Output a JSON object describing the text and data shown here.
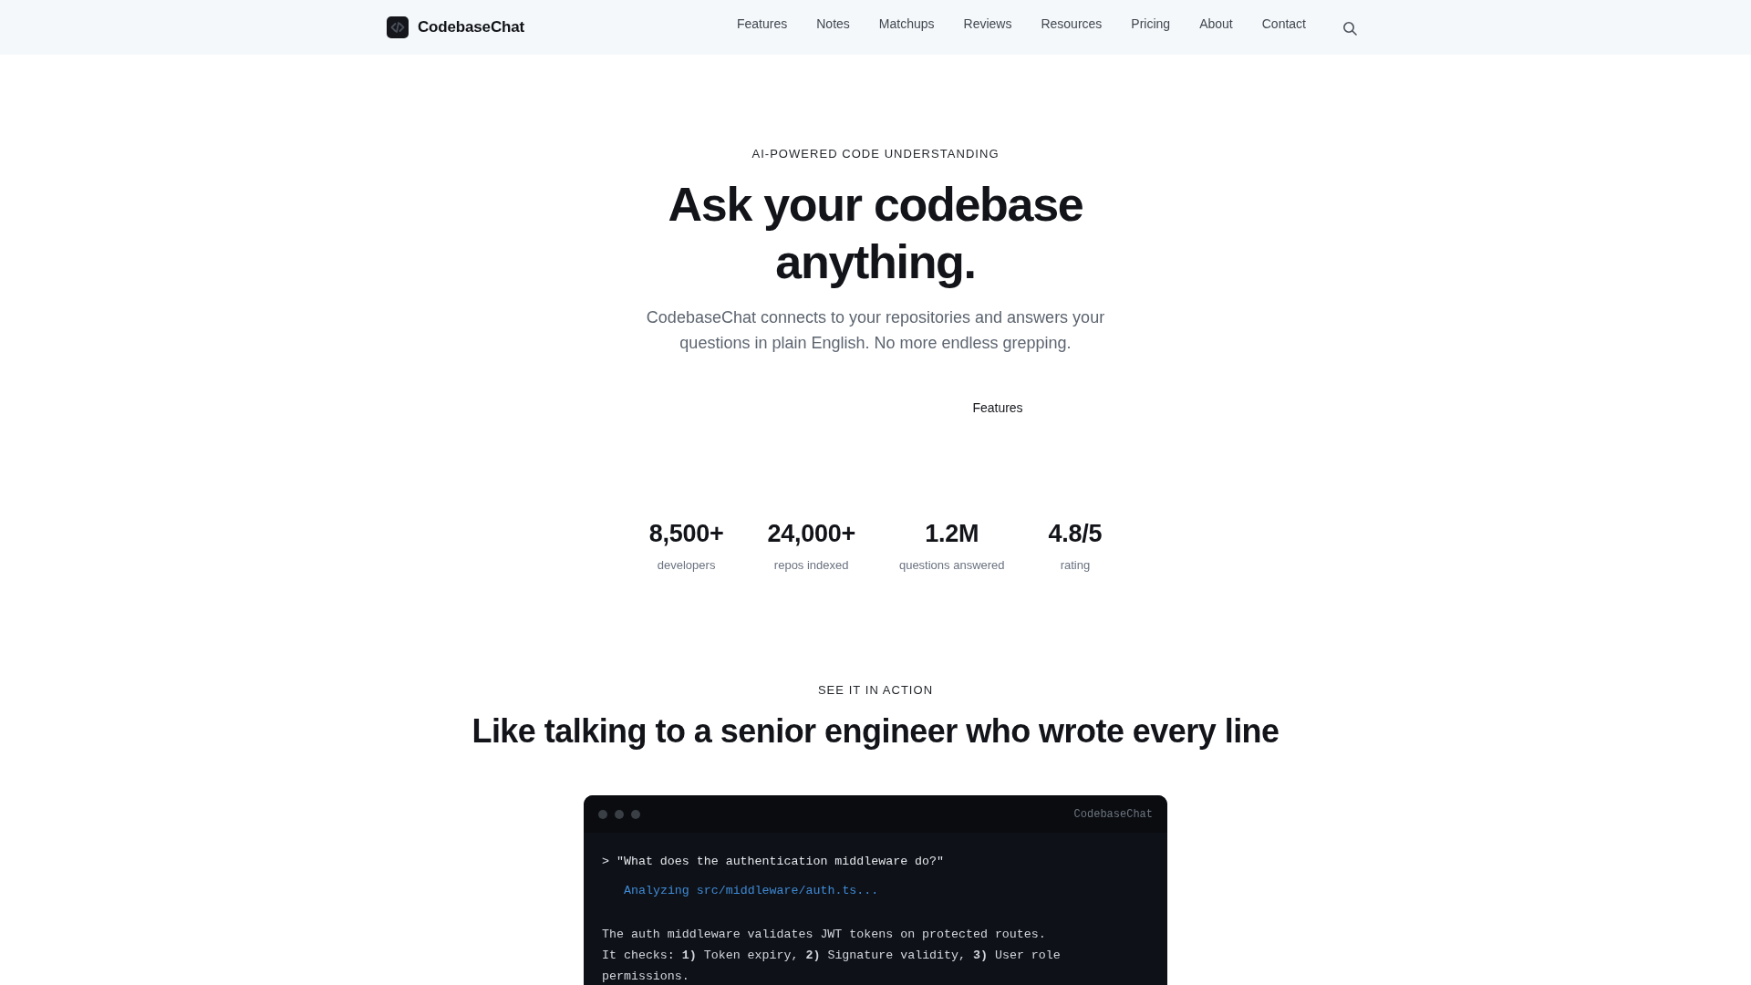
{
  "nav": {
    "brand": "CodebaseChat",
    "links": [
      "Features",
      "Notes",
      "Matchups",
      "Reviews",
      "Resources",
      "Pricing",
      "About",
      "Contact"
    ]
  },
  "hero": {
    "eyebrow": "AI-POWERED CODE UNDERSTANDING",
    "title": "Ask your codebase anything.",
    "subtitle": "CodebaseChat connects to your repositories and answers your questions in plain English. No more endless grepping.",
    "secondary_link": "Features"
  },
  "stats": [
    {
      "value": "8,500+",
      "label": "developers"
    },
    {
      "value": "24,000+",
      "label": "repos indexed"
    },
    {
      "value": "1.2M",
      "label": "questions answered"
    },
    {
      "value": "4.8/5",
      "label": "rating"
    }
  ],
  "demo": {
    "eyebrow": "SEE IT IN ACTION",
    "title": "Like talking to a senior engineer who wrote every line",
    "terminal": {
      "title": "CodebaseChat",
      "prompt": "> \"What does the authentication middleware do?\"",
      "status": "Analyzing src/middleware/auth.ts...",
      "response": [
        "The auth middleware validates JWT tokens on protected routes.",
        "It checks: **1)** Token expiry, **2)** Signature validity, **3)** User role permissions."
      ]
    }
  }
}
